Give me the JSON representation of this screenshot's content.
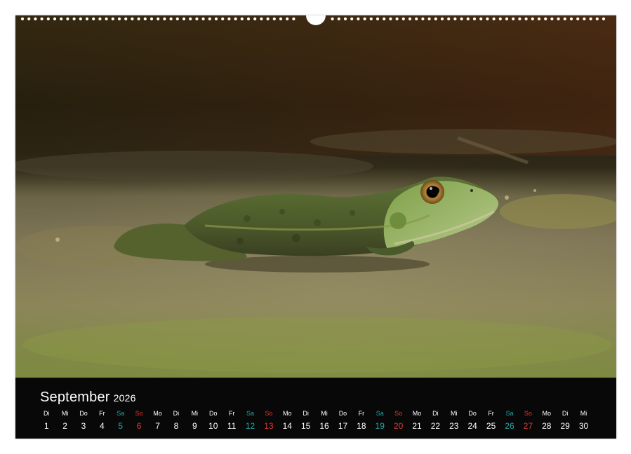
{
  "calendar": {
    "month": "September",
    "year": "2026",
    "days": [
      {
        "name": "Di",
        "num": "1",
        "type": "weekday"
      },
      {
        "name": "Mi",
        "num": "2",
        "type": "weekday"
      },
      {
        "name": "Do",
        "num": "3",
        "type": "weekday"
      },
      {
        "name": "Fr",
        "num": "4",
        "type": "weekday"
      },
      {
        "name": "Sa",
        "num": "5",
        "type": "sat"
      },
      {
        "name": "So",
        "num": "6",
        "type": "sun"
      },
      {
        "name": "Mo",
        "num": "7",
        "type": "weekday"
      },
      {
        "name": "Di",
        "num": "8",
        "type": "weekday"
      },
      {
        "name": "Mi",
        "num": "9",
        "type": "weekday"
      },
      {
        "name": "Do",
        "num": "10",
        "type": "weekday"
      },
      {
        "name": "Fr",
        "num": "11",
        "type": "weekday"
      },
      {
        "name": "Sa",
        "num": "12",
        "type": "sat"
      },
      {
        "name": "So",
        "num": "13",
        "type": "sun"
      },
      {
        "name": "Mo",
        "num": "14",
        "type": "weekday"
      },
      {
        "name": "Di",
        "num": "15",
        "type": "weekday"
      },
      {
        "name": "Mi",
        "num": "16",
        "type": "weekday"
      },
      {
        "name": "Do",
        "num": "17",
        "type": "weekday"
      },
      {
        "name": "Fr",
        "num": "18",
        "type": "weekday"
      },
      {
        "name": "Sa",
        "num": "19",
        "type": "sat"
      },
      {
        "name": "So",
        "num": "20",
        "type": "sun"
      },
      {
        "name": "Mo",
        "num": "21",
        "type": "weekday"
      },
      {
        "name": "Di",
        "num": "22",
        "type": "weekday"
      },
      {
        "name": "Mi",
        "num": "23",
        "type": "weekday"
      },
      {
        "name": "Do",
        "num": "24",
        "type": "weekday"
      },
      {
        "name": "Fr",
        "num": "25",
        "type": "weekday"
      },
      {
        "name": "Sa",
        "num": "26",
        "type": "sat"
      },
      {
        "name": "So",
        "num": "27",
        "type": "sun"
      },
      {
        "name": "Mo",
        "num": "28",
        "type": "weekday"
      },
      {
        "name": "Di",
        "num": "29",
        "type": "weekday"
      },
      {
        "name": "Mi",
        "num": "30",
        "type": "weekday"
      }
    ]
  },
  "colors": {
    "saturday": "#27a6a3",
    "sunday": "#e03a2e",
    "calendar_background": "#080808",
    "text": "#ffffff"
  },
  "photo": {
    "subject": "frog-photo"
  }
}
